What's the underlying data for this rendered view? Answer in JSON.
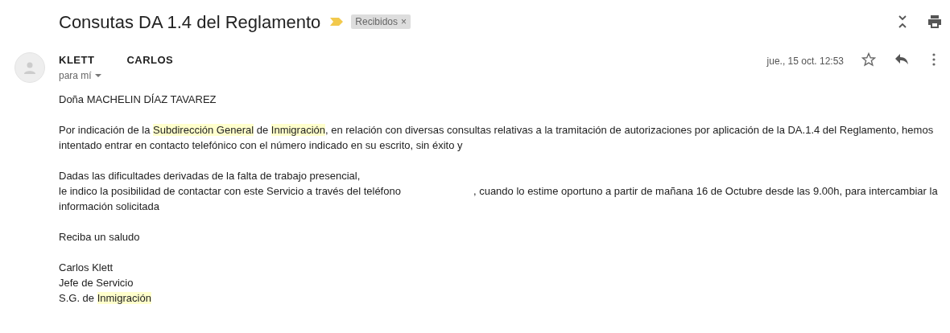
{
  "subject": "Consutas DA 1.4 del Reglamento",
  "important": true,
  "label": {
    "text": "Recibidos",
    "remove": "×"
  },
  "sender": {
    "parts": [
      "KLETT",
      "CARLOS"
    ],
    "recipient": "para mí"
  },
  "date": "jue., 15 oct. 12:53",
  "starred": false,
  "body": [
    [
      [
        {
          "text": "Doña MACHELIN DÍAZ TAVAREZ",
          "highlighted": false
        }
      ]
    ],
    [
      [
        {
          "text": "Por indicación de la ",
          "highlighted": false
        },
        {
          "text": "Subdirección General",
          "highlighted": true
        },
        {
          "text": " de ",
          "highlighted": false
        },
        {
          "text": "Inmigración",
          "highlighted": true
        },
        {
          "text": ", en relación con diversas consultas relativas a la tramitación de autorizaciones por aplicación de la DA.1.4 del Reglamento, hemos intentado entrar en contacto telefónico con el número indicado en su escrito, sin éxito y",
          "highlighted": false
        }
      ]
    ],
    [
      [
        {
          "text": "Dadas las dificultades derivadas de la falta de trabajo presencial,",
          "highlighted": false
        }
      ],
      [
        {
          "text": "le indico la posibilidad de contactar con este Servicio a través del teléfono",
          "highlighted": false
        },
        {
          "kind": "gap"
        },
        {
          "text": ", cuando lo estime oportuno a partir de mañana 16 de Octubre desde las 9.00h, para intercambiar la información solicitada",
          "highlighted": false
        }
      ]
    ],
    [
      [
        {
          "text": "Reciba un saludo",
          "highlighted": false
        }
      ]
    ],
    [
      [
        {
          "text": "Carlos Klett",
          "highlighted": false
        }
      ],
      [
        {
          "text": "Jefe de Servicio",
          "highlighted": false
        }
      ],
      [
        {
          "text": "S.G. de ",
          "highlighted": false
        },
        {
          "text": "Inmigración",
          "highlighted": true
        }
      ]
    ]
  ]
}
